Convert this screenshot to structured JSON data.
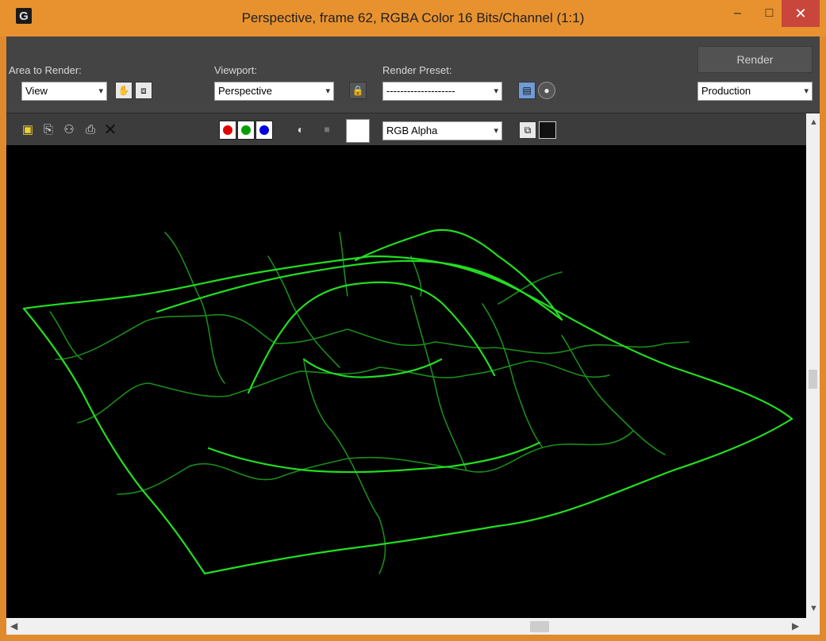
{
  "window": {
    "title": "Perspective, frame 62, RGBA Color 16 Bits/Channel (1:1)",
    "app_icon_glyph": "G"
  },
  "titlebar_buttons": {
    "minimize": "–",
    "maximize": "□",
    "close": "✕"
  },
  "area_to_render": {
    "label": "Area to Render:",
    "value": "View"
  },
  "viewport_select": {
    "label": "Viewport:",
    "value": "Perspective"
  },
  "render_preset": {
    "label": "Render Preset:",
    "value": "--------------------"
  },
  "render_button": {
    "label": "Render"
  },
  "production_select": {
    "value": "Production"
  },
  "channel_select": {
    "value": "RGB Alpha"
  },
  "colors": {
    "wireframe": "#22dd22",
    "wireframe_dim": "#1a8c1a",
    "titlebar": "#e8922f",
    "close_button": "#c9463c"
  },
  "icons": [
    "crop-region-icon",
    "region-icon",
    "lock-icon",
    "preset-files-icon",
    "environment-icon",
    "save-image-icon",
    "copy-image-icon",
    "clone-window-icon",
    "print-icon",
    "clear-icon",
    "red-channel-icon",
    "green-channel-icon",
    "blue-channel-icon",
    "mono-channel-icon",
    "alpha-channel-icon",
    "display-toggle-icon"
  ]
}
